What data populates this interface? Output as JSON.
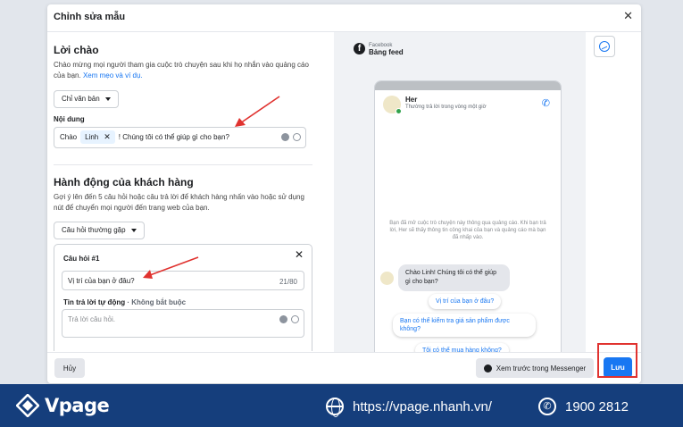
{
  "dialog": {
    "title": "Chỉnh sửa mẫu",
    "close": "✕"
  },
  "greeting": {
    "heading": "Lời chào",
    "desc": "Chào mừng mọi người tham gia cuộc trò chuyện sau khi họ nhắn vào quảng cáo của bạn.",
    "link": "Xem mẹo và ví dụ.",
    "format_select": "Chỉ văn bản",
    "content_label": "Nội dung",
    "text_before": "Chào",
    "chip": "Linh",
    "chip_remove": "✕",
    "text_after": "! Chúng tôi có thể giúp gì cho bạn?"
  },
  "customer_actions": {
    "heading": "Hành động của khách hàng",
    "desc": "Gợi ý lên đến 5 câu hỏi hoặc câu trả lời để khách hàng nhấn vào hoặc sử dụng nút để chuyển mọi người đến trang web của bạn.",
    "type_select": "Câu hỏi thường gặp",
    "question": {
      "title": "Câu hỏi #1",
      "close": "✕",
      "value": "Vị trí của bạn ở đâu?",
      "counter": "21/80",
      "auto_reply_label": "Tin trả lời tự động",
      "auto_reply_optional": "· Không bắt buộc",
      "auto_reply_placeholder": "Trả lời câu hỏi."
    }
  },
  "preview": {
    "platform_small": "Facebook",
    "platform_big": "Bảng feed",
    "page_name": "Her",
    "status": "Thường trả lời trong vòng một giờ",
    "notice": "Bạn đã mở cuộc trò chuyện này thông qua quảng cáo. Khi bạn trả lời, Her sẽ thấy thông tin công khai của bạn và quảng cáo mà bạn đã nhấp vào.",
    "bot_message": "Chào Linh! Chúng tôi có thể giúp gì cho bạn?",
    "quick_replies": [
      "Vị trí của bạn ở đâu?",
      "Bạn có thể kiểm tra giá sản phẩm được không?",
      "Tôi có thể mua hàng không?"
    ]
  },
  "footer": {
    "cancel": "Hủy",
    "preview_messenger": "Xem trước trong Messenger",
    "save": "Lưu"
  },
  "banner": {
    "brand": "Vpage",
    "website": "https://vpage.nhanh.vn/",
    "phone": "1900 2812"
  },
  "colors": {
    "accent": "#1877f2",
    "annotation": "#e0322f",
    "banner": "#153e7c"
  },
  "icons": [
    "close-icon",
    "caret-down-icon",
    "emoji-icon",
    "personalize-icon",
    "facebook-icon",
    "phone-call-icon",
    "messenger-icon",
    "globe-icon",
    "phone-icon"
  ]
}
